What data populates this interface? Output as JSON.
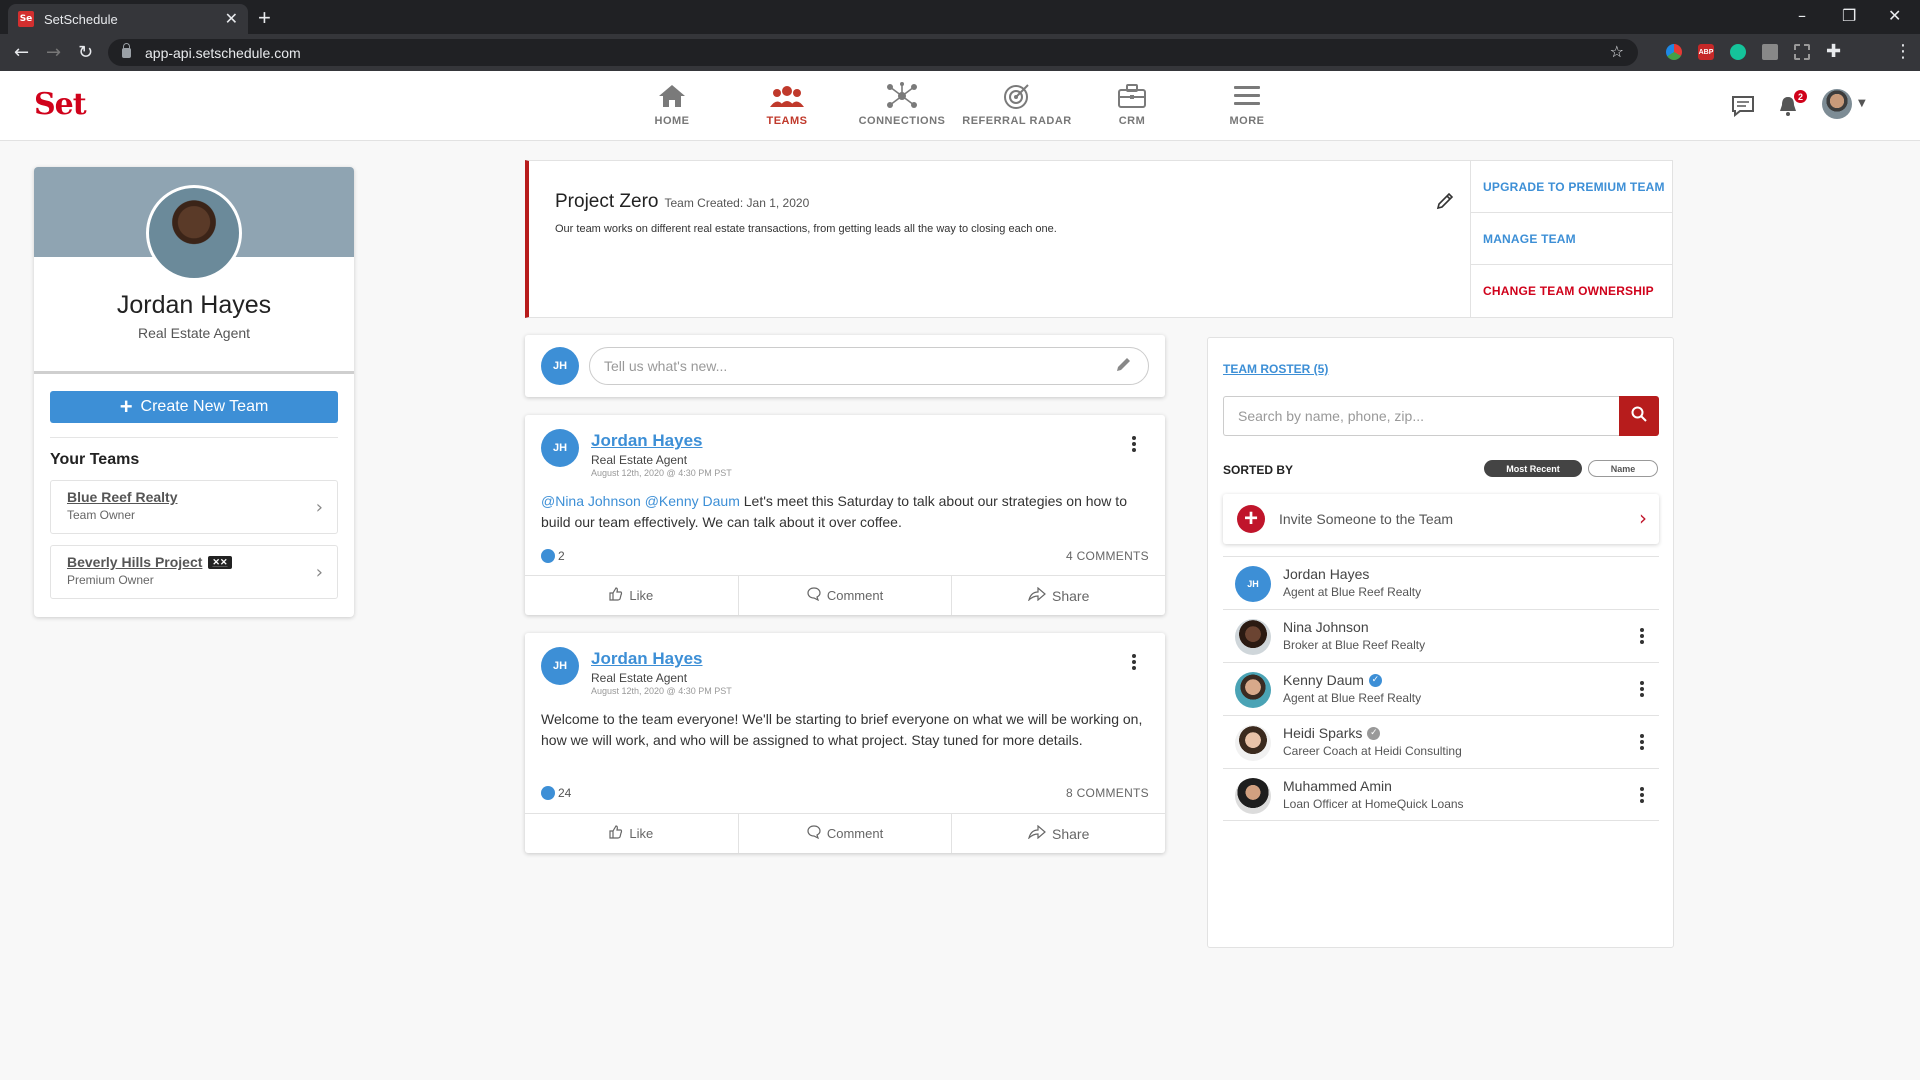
{
  "browser": {
    "tab_title": "SetSchedule",
    "favicon_text": "Se",
    "url": "app-api.setschedule.com"
  },
  "header": {
    "logo": "Set",
    "nav": [
      {
        "label": "HOME",
        "icon": "home-icon"
      },
      {
        "label": "TEAMS",
        "icon": "teams-icon"
      },
      {
        "label": "CONNECTIONS",
        "icon": "connections-icon"
      },
      {
        "label": "REFERRAL RADAR",
        "icon": "radar-icon"
      },
      {
        "label": "CRM",
        "icon": "briefcase-icon"
      },
      {
        "label": "MORE",
        "icon": "menu-icon"
      }
    ],
    "notification_count": "2"
  },
  "profile": {
    "name": "Jordan Hayes",
    "role": "Real Estate Agent",
    "create_button": "Create New Team",
    "your_teams_heading": "Your Teams",
    "teams": [
      {
        "name": "Blue Reef Realty",
        "role": "Team Owner"
      },
      {
        "name": "Beverly Hills Project",
        "role": "Premium Owner"
      }
    ]
  },
  "team": {
    "name": "Project Zero",
    "created": "Team Created: Jan 1, 2020",
    "description": "Our team works on different real estate transactions, from getting leads all the way to closing each one.",
    "actions": [
      "UPGRADE TO PREMIUM TEAM",
      "MANAGE TEAM",
      "CHANGE TEAM OWNERSHIP"
    ]
  },
  "composer": {
    "initials": "JH",
    "placeholder": "Tell us what's new..."
  },
  "posts": [
    {
      "initials": "JH",
      "author": "Jordan Hayes",
      "role": "Real Estate Agent",
      "time": "August 12th, 2020 @ 4:30 PM PST",
      "mention1": "@Nina Johnson",
      "mention2": "@Kenny Daum",
      "body": " Let's meet this Saturday to talk about our strategies on how to build our team effectively. We can talk about it over coffee.",
      "likes": "2",
      "comments": "4 COMMENTS"
    },
    {
      "initials": "JH",
      "author": "Jordan Hayes",
      "role": "Real Estate Agent",
      "time": "August 12th, 2020 @ 4:30 PM PST",
      "body": "Welcome to the team everyone! We'll be starting to brief everyone on what we will be working on, how we will work, and who will be assigned to what project. Stay tuned for more details.",
      "likes": "24",
      "comments": "8 COMMENTS"
    }
  ],
  "post_actions": {
    "like": "Like",
    "comment": "Comment",
    "share": "Share"
  },
  "roster": {
    "title": "TEAM ROSTER (5)",
    "search_placeholder": "Search by name, phone, zip...",
    "sorted_by": "SORTED BY",
    "sort_options": [
      "Most Recent",
      "Name"
    ],
    "invite": "Invite Someone to the Team",
    "members": [
      {
        "name": "Jordan Hayes",
        "subtitle": "Agent at Blue Reef Realty",
        "initials": "JH",
        "verified": "none"
      },
      {
        "name": "Nina Johnson",
        "subtitle": "Broker at Blue Reef Realty",
        "verified": "none"
      },
      {
        "name": "Kenny Daum",
        "subtitle": "Agent at Blue Reef Realty",
        "verified": "blue"
      },
      {
        "name": "Heidi Sparks",
        "subtitle": "Career Coach at Heidi Consulting",
        "verified": "gray"
      },
      {
        "name": "Muhammed Amin",
        "subtitle": "Loan Officer at HomeQuick Loans",
        "verified": "none"
      }
    ]
  },
  "colors": {
    "accent_blue": "#3d8fd6",
    "brand_red": "#d0021b",
    "active_nav": "#c0392b"
  }
}
